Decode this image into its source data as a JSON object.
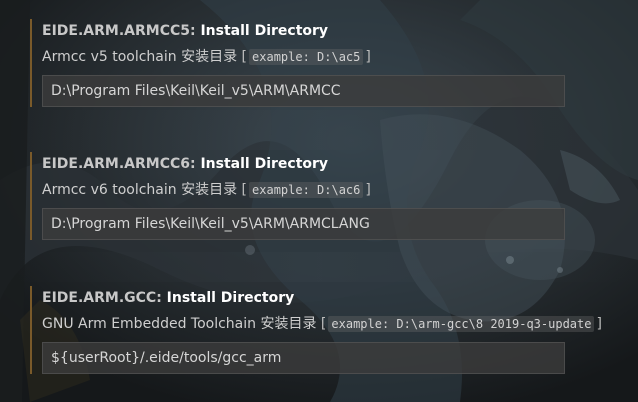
{
  "settings": [
    {
      "prefix": "EIDE.ARM.ARMCC5",
      "name": "Install Directory",
      "description": "Armcc v5 toolchain 安装目录",
      "example": "example: D:\\ac5",
      "value": "D:\\Program Files\\Keil\\Keil_v5\\ARM\\ARMCC"
    },
    {
      "prefix": "EIDE.ARM.ARMCC6",
      "name": "Install Directory",
      "description": "Armcc v6 toolchain 安装目录",
      "example": "example: D:\\ac6",
      "value": "D:\\Program Files\\Keil\\Keil_v5\\ARM\\ARMCLANG"
    },
    {
      "prefix": "EIDE.ARM.GCC",
      "name": "Install Directory",
      "description": "GNU Arm Embedded Toolchain 安装目录",
      "example": "example: D:\\arm-gcc\\8 2019-q3-update",
      "value": "${userRoot}/.eide/tools/gcc_arm"
    }
  ],
  "colors": {
    "background": "#1b1f22",
    "accent_border": "#7a5a2a",
    "input_background": "#3c3c3c"
  }
}
